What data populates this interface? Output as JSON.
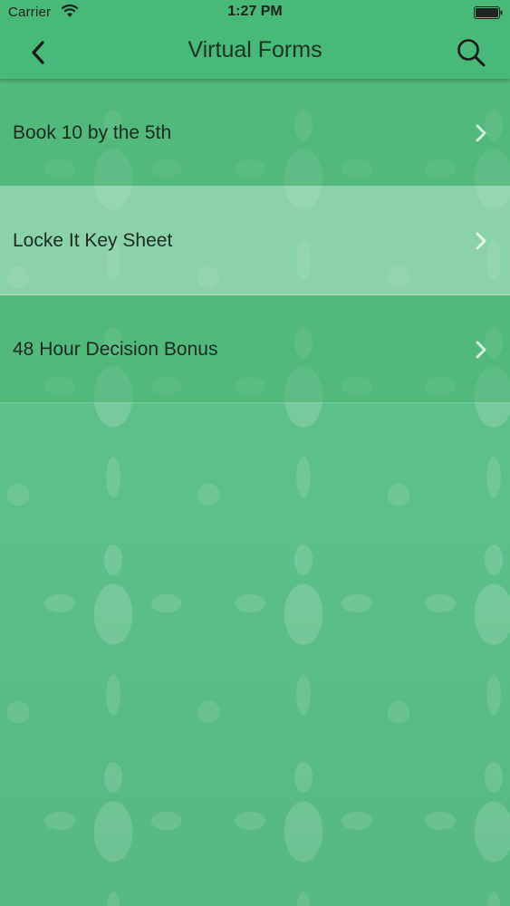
{
  "status_bar": {
    "carrier": "Carrier",
    "time": "1:27 PM",
    "wifi_icon": "wifi-icon",
    "battery_icon": "battery-icon"
  },
  "nav": {
    "title": "Virtual Forms",
    "back_icon": "chevron-left-icon",
    "search_icon": "search-icon"
  },
  "list": {
    "items": [
      {
        "label": "Book 10 by the 5th"
      },
      {
        "label": "Locke It Key Sheet"
      },
      {
        "label": "48 Hour Decision Bonus"
      }
    ],
    "chevron_icon": "chevron-right-icon"
  },
  "colors": {
    "header": "#47b978",
    "background": "#5cc08a",
    "highlight_row": "#a8dcbc",
    "text": "#1d2a22"
  }
}
